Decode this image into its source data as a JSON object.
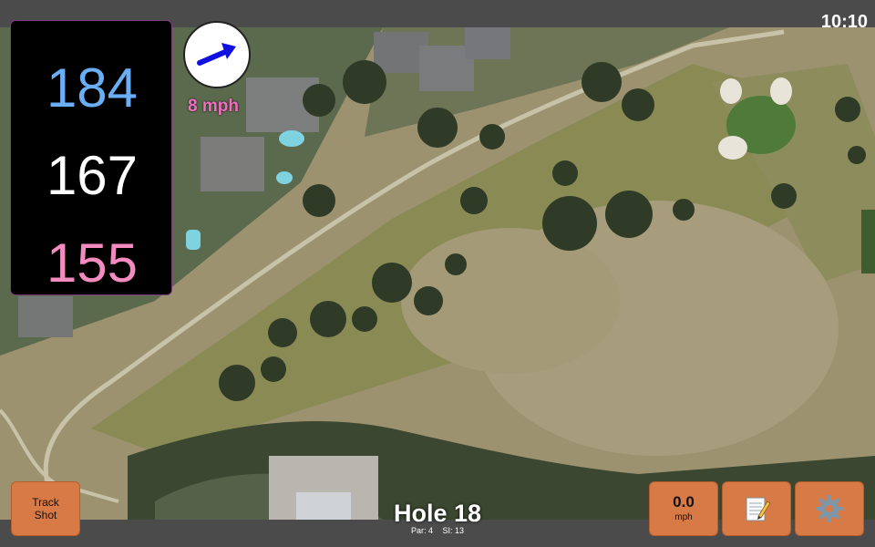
{
  "status_bar": {
    "time": "10:10"
  },
  "distances": {
    "back": "184",
    "middle": "167",
    "front": "155"
  },
  "wind": {
    "speed_label": "8 mph",
    "direction_icon": "arrow-right-icon"
  },
  "hole": {
    "title": "Hole 18",
    "par": "Par: 4",
    "stroke_index": "SI: 13"
  },
  "buttons": {
    "track_shot_line1": "Track",
    "track_shot_line2": "Shot",
    "wind_value": "0.0",
    "wind_unit": "mph",
    "notes_icon": "notepad-icon",
    "settings_icon": "gear-icon"
  },
  "colors": {
    "back_distance": "#6aaef5",
    "middle_distance": "#ffffff",
    "front_distance": "#f48bc0",
    "wind_arrow": "#1010e0",
    "button": "#d77a45",
    "green": "#4f7a3a"
  }
}
